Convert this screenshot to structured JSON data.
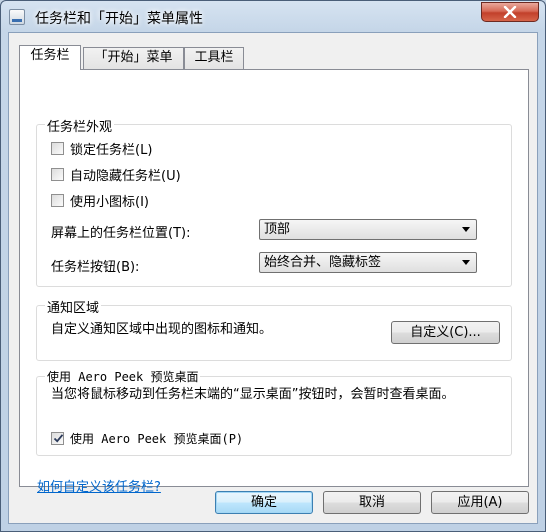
{
  "window": {
    "title": "任务栏和「开始」菜单属性"
  },
  "tabs": [
    {
      "label": "任务栏",
      "active": true
    },
    {
      "label": "「开始」菜单",
      "active": false
    },
    {
      "label": "工具栏",
      "active": false
    }
  ],
  "appearance": {
    "title": "任务栏外观",
    "lock": {
      "label": "锁定任务栏(L)",
      "checked": false
    },
    "autohide": {
      "label": "自动隐藏任务栏(U)",
      "checked": false
    },
    "small_icons": {
      "label": "使用小图标(I)",
      "checked": false
    },
    "location_label": "屏幕上的任务栏位置(T):",
    "location_value": "顶部",
    "buttons_label": "任务栏按钮(B):",
    "buttons_value": "始终合并、隐藏标签"
  },
  "notification": {
    "title": "通知区域",
    "description": "自定义通知区域中出现的图标和通知。",
    "customize_button": "自定义(C)..."
  },
  "aero_peek": {
    "title": "使用 Aero Peek 预览桌面",
    "description": "当您将鼠标移动到任务栏末端的“显示桌面”按钮时，会暂时查看桌面。",
    "checkbox_label": "使用 Aero Peek 预览桌面(P)",
    "checked": true
  },
  "help_link": "如何自定义该任务栏?",
  "footer": {
    "ok": "确定",
    "cancel": "取消",
    "apply": "应用(A)"
  }
}
